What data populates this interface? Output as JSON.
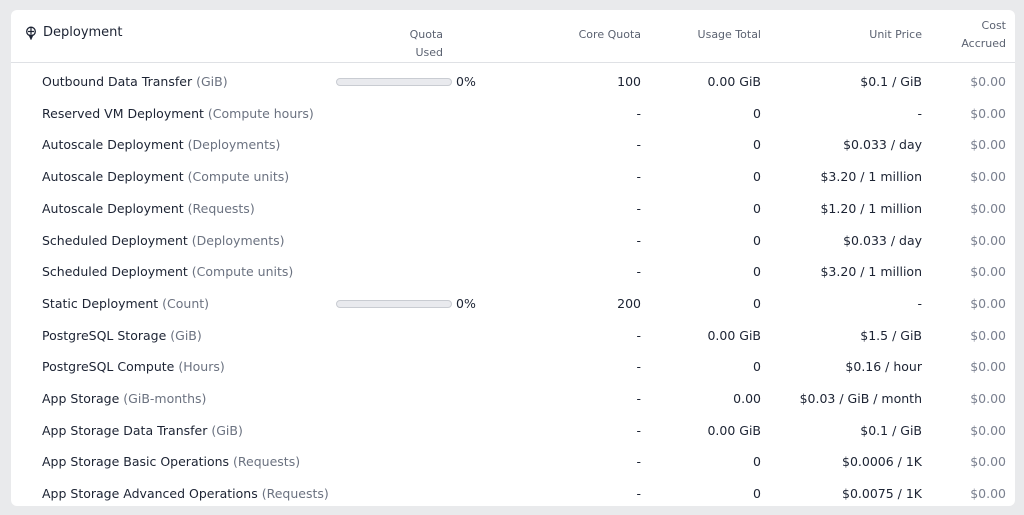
{
  "header": {
    "title": "Deployment",
    "quota_used": "Quota Used",
    "core_quota": "Core Quota",
    "usage_total": "Usage Total",
    "unit_price": "Unit Price",
    "cost_accrued_line1": "Cost",
    "cost_accrued_line2": "Accrued"
  },
  "rows": [
    {
      "name": "Outbound Data Transfer",
      "unit": "(GiB)",
      "quota_pct": "0%",
      "quota_fraction": 0,
      "core": "100",
      "usage": "0.00 GiB",
      "price": "$0.1 / GiB",
      "cost": "$0.00"
    },
    {
      "name": "Reserved VM Deployment",
      "unit": "(Compute hours)",
      "quota_pct": "",
      "core": "-",
      "usage": "0",
      "price": "-",
      "cost": "$0.00"
    },
    {
      "name": "Autoscale Deployment",
      "unit": "(Deployments)",
      "quota_pct": "",
      "core": "-",
      "usage": "0",
      "price": "$0.033 / day",
      "cost": "$0.00"
    },
    {
      "name": "Autoscale Deployment",
      "unit": "(Compute units)",
      "quota_pct": "",
      "core": "-",
      "usage": "0",
      "price": "$3.20 / 1 million",
      "cost": "$0.00"
    },
    {
      "name": "Autoscale Deployment",
      "unit": "(Requests)",
      "quota_pct": "",
      "core": "-",
      "usage": "0",
      "price": "$1.20 / 1 million",
      "cost": "$0.00"
    },
    {
      "name": "Scheduled Deployment",
      "unit": "(Deployments)",
      "quota_pct": "",
      "core": "-",
      "usage": "0",
      "price": "$0.033 / day",
      "cost": "$0.00"
    },
    {
      "name": "Scheduled Deployment",
      "unit": "(Compute units)",
      "quota_pct": "",
      "core": "-",
      "usage": "0",
      "price": "$3.20 / 1 million",
      "cost": "$0.00"
    },
    {
      "name": "Static Deployment",
      "unit": "(Count)",
      "quota_pct": "0%",
      "quota_fraction": 0,
      "core": "200",
      "usage": "0",
      "price": "-",
      "cost": "$0.00"
    },
    {
      "name": "PostgreSQL Storage",
      "unit": "(GiB)",
      "quota_pct": "",
      "core": "-",
      "usage": "0.00 GiB",
      "price": "$1.5 / GiB",
      "cost": "$0.00"
    },
    {
      "name": "PostgreSQL Compute",
      "unit": "(Hours)",
      "quota_pct": "",
      "core": "-",
      "usage": "0",
      "price": "$0.16 / hour",
      "cost": "$0.00"
    },
    {
      "name": "App Storage",
      "unit": "(GiB-months)",
      "quota_pct": "",
      "core": "-",
      "usage": "0.00",
      "price": "$0.03 / GiB / month",
      "cost": "$0.00"
    },
    {
      "name": "App Storage Data Transfer",
      "unit": "(GiB)",
      "quota_pct": "",
      "core": "-",
      "usage": "0.00 GiB",
      "price": "$0.1 / GiB",
      "cost": "$0.00"
    },
    {
      "name": "App Storage Basic Operations",
      "unit": "(Requests)",
      "quota_pct": "",
      "core": "-",
      "usage": "0",
      "price": "$0.0006 / 1K",
      "cost": "$0.00"
    },
    {
      "name": "App Storage Advanced Operations",
      "unit": "(Requests)",
      "quota_pct": "",
      "core": "-",
      "usage": "0",
      "price": "$0.0075 / 1K",
      "cost": "$0.00"
    }
  ]
}
